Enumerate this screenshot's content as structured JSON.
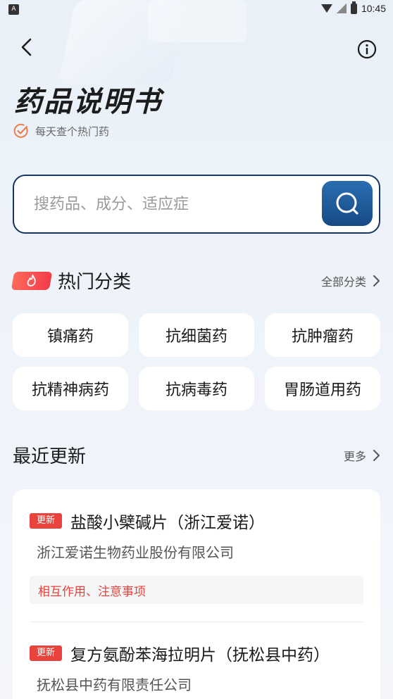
{
  "status_bar": {
    "app_badge": "A",
    "time": "10:45"
  },
  "header": {
    "title": "药品说明书",
    "subtitle": "每天查个热门药"
  },
  "search": {
    "placeholder": "搜药品、成分、适应症",
    "value": ""
  },
  "hot_categories": {
    "title": "热门分类",
    "all_label": "全部分类",
    "items": [
      {
        "label": "镇痛药"
      },
      {
        "label": "抗细菌药"
      },
      {
        "label": "抗肿瘤药"
      },
      {
        "label": "抗精神病药"
      },
      {
        "label": "抗病毒药"
      },
      {
        "label": "胃肠道用药"
      }
    ]
  },
  "recent_updates": {
    "title": "最近更新",
    "more_label": "更多",
    "items": [
      {
        "badge": "更新",
        "name": "盐酸小檗碱片（浙江爱诺）",
        "company": "浙江爱诺生物药业股份有限公司",
        "tags": "相互作用、注意事项"
      },
      {
        "badge": "更新",
        "name": "复方氨酚苯海拉明片（抚松县中药）",
        "company": "抚松县中药有限责任公司",
        "tags": ""
      }
    ]
  },
  "colors": {
    "accent_navy": "#16365e",
    "search_button": "#1f5d9e",
    "badge_red": "#e8433c",
    "check_orange": "#f07c4a"
  }
}
